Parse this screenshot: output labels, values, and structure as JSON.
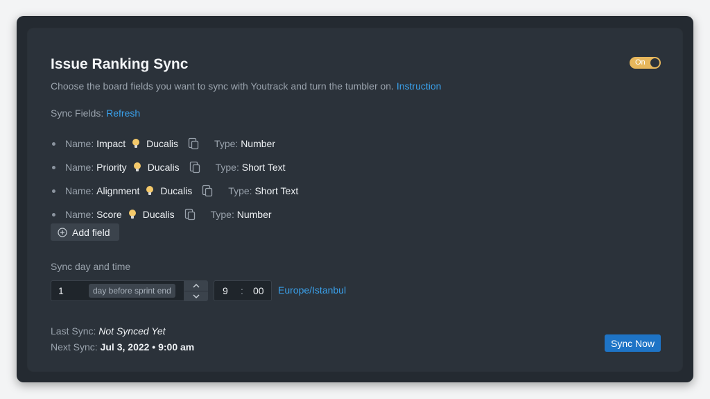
{
  "header": {
    "title": "Issue Ranking Sync",
    "toggle_label": "On",
    "toggle_state": "on"
  },
  "description": {
    "text": "Choose the board fields you want to sync with Youtrack and turn the tumbler on.",
    "link": "Instruction"
  },
  "sync_fields": {
    "label": "Sync Fields:",
    "refresh": "Refresh",
    "name_label": "Name:",
    "type_label": "Type:",
    "items": [
      {
        "name": "Impact",
        "source": "Ducalis",
        "type": "Number"
      },
      {
        "name": "Priority",
        "source": "Ducalis",
        "type": "Short Text"
      },
      {
        "name": "Alignment",
        "source": "Ducalis",
        "type": "Short Text"
      },
      {
        "name": "Score",
        "source": "Ducalis",
        "type": "Number"
      }
    ],
    "add_label": "Add field"
  },
  "schedule": {
    "label": "Sync day and time",
    "day_value": "1",
    "day_suffix": "day before sprint end",
    "hour": "9",
    "separator": ":",
    "minute": "00",
    "timezone": "Europe/Istanbul"
  },
  "status": {
    "last_label": "Last Sync:",
    "last_value": "Not Synced Yet",
    "next_label": "Next Sync:",
    "next_value": "Jul 3, 2022 • 9:00 am"
  },
  "actions": {
    "sync_now": "Sync Now"
  },
  "icons": {
    "source": "bulb-icon",
    "copy": "copy-icon",
    "add": "plus-circle-icon",
    "step_up": "chevron-up-icon",
    "step_down": "chevron-down-icon"
  },
  "colors": {
    "accent": "#3aa0ea",
    "toggle": "#e7b75c",
    "primary_button": "#1e74c6",
    "card": "#2b323a"
  }
}
